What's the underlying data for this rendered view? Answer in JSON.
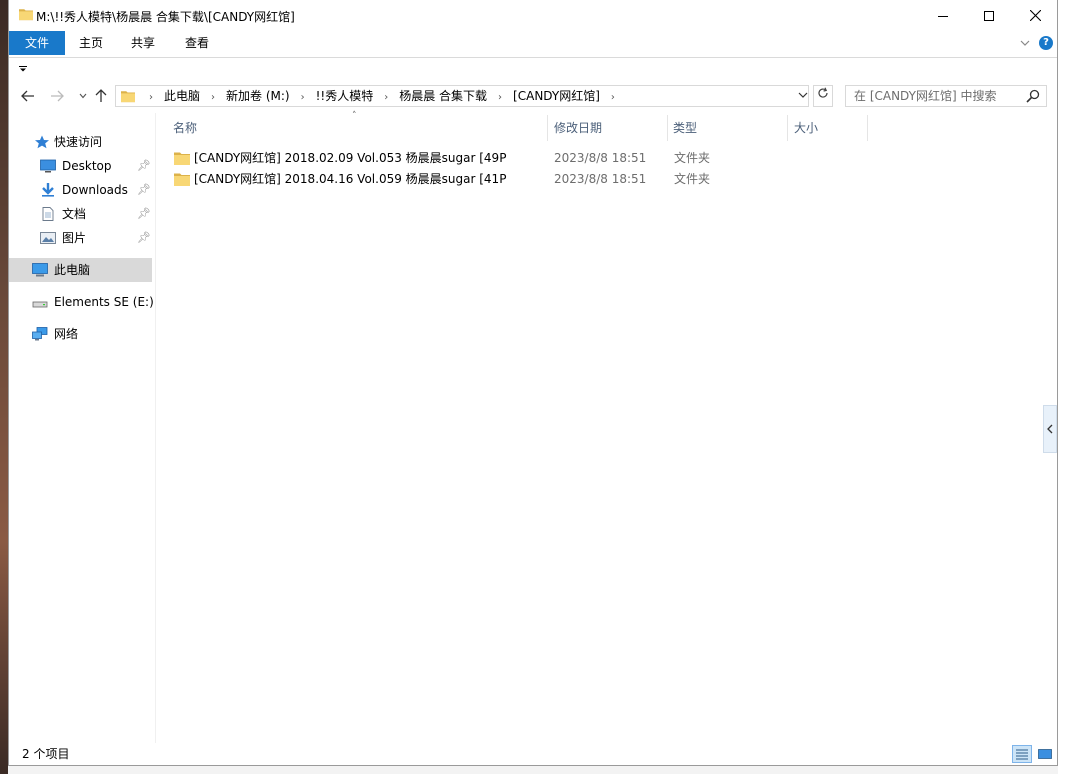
{
  "window": {
    "title": "M:\\!!秀人模特\\杨晨晨 合集下载\\[CANDY网红馆]"
  },
  "ribbon": {
    "tabs": [
      "文件",
      "主页",
      "共享",
      "查看"
    ],
    "help_label": "?"
  },
  "address": {
    "crumbs": [
      "此电脑",
      "新加卷 (M:)",
      "!!秀人模特",
      "杨晨晨 合集下载",
      "[CANDY网红馆]"
    ],
    "search_placeholder": "在 [CANDY网红馆] 中搜索"
  },
  "sidebar": {
    "items": [
      {
        "label": "快速访问",
        "icon": "star-icon"
      },
      {
        "label": "Desktop",
        "icon": "desktop-icon",
        "pinned": true
      },
      {
        "label": "Downloads",
        "icon": "download-icon",
        "pinned": true
      },
      {
        "label": "文档",
        "icon": "document-icon",
        "pinned": true
      },
      {
        "label": "图片",
        "icon": "picture-icon",
        "pinned": true
      },
      {
        "label": "此电脑",
        "icon": "computer-icon",
        "selected": true
      },
      {
        "label": "Elements SE (E:)",
        "icon": "drive-icon"
      },
      {
        "label": "网络",
        "icon": "network-icon"
      }
    ]
  },
  "columns": {
    "name": "名称",
    "date": "修改日期",
    "type": "类型",
    "size": "大小"
  },
  "files": [
    {
      "name": "[CANDY网红馆] 2018.02.09 Vol.053 杨晨晨sugar [49P",
      "date": "2023/8/8 18:51",
      "type": "文件夹"
    },
    {
      "name": "[CANDY网红馆] 2018.04.16 Vol.059 杨晨晨sugar [41P",
      "date": "2023/8/8 18:51",
      "type": "文件夹"
    }
  ],
  "status": {
    "count": "2 个项目"
  },
  "colors": {
    "accent": "#1979ca",
    "folder": "#f8d775",
    "header_text": "#4c607a",
    "selected_bg": "#d9d9d9"
  }
}
